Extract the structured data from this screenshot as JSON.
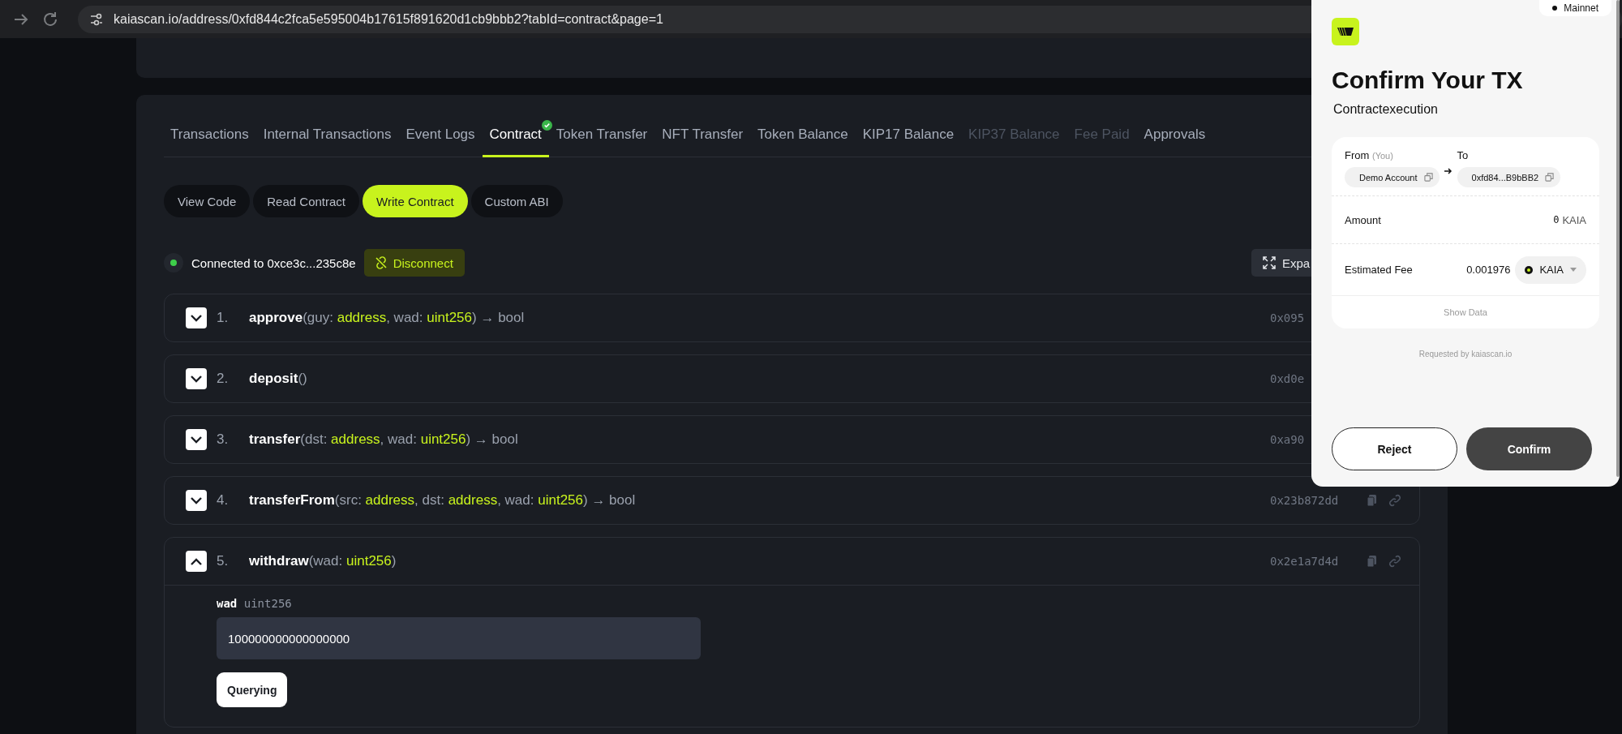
{
  "browser": {
    "url": "kaiascan.io/address/0xfd844c2fca5e595004b17615f891620d1cb9bbb2?tabId=contract&page=1"
  },
  "tabs": [
    {
      "label": "Transactions",
      "selected": false,
      "disabled": false,
      "verified": false
    },
    {
      "label": "Internal Transactions",
      "selected": false,
      "disabled": false,
      "verified": false
    },
    {
      "label": "Event Logs",
      "selected": false,
      "disabled": false,
      "verified": false
    },
    {
      "label": "Contract",
      "selected": true,
      "disabled": false,
      "verified": true
    },
    {
      "label": "Token Transfer",
      "selected": false,
      "disabled": false,
      "verified": false
    },
    {
      "label": "NFT Transfer",
      "selected": false,
      "disabled": false,
      "verified": false
    },
    {
      "label": "Token Balance",
      "selected": false,
      "disabled": false,
      "verified": false
    },
    {
      "label": "KIP17 Balance",
      "selected": false,
      "disabled": false,
      "verified": false
    },
    {
      "label": "KIP37 Balance",
      "selected": false,
      "disabled": true,
      "verified": false
    },
    {
      "label": "Fee Paid",
      "selected": false,
      "disabled": true,
      "verified": false
    },
    {
      "label": "Approvals",
      "selected": false,
      "disabled": false,
      "verified": false
    }
  ],
  "subtabs": [
    {
      "label": "View Code",
      "selected": false
    },
    {
      "label": "Read Contract",
      "selected": false
    },
    {
      "label": "Write Contract",
      "selected": true
    },
    {
      "label": "Custom ABI",
      "selected": false
    }
  ],
  "connection": {
    "connected": true,
    "text": "Connected to 0xce3c...235c8e",
    "disconnect_label": "Disconnect",
    "expand_label": "Expa"
  },
  "functions": [
    {
      "number": "1.",
      "signature": [
        {
          "kind": "name",
          "text": "approve"
        },
        {
          "kind": "plain",
          "text": "(guy: "
        },
        {
          "kind": "type",
          "text": "address"
        },
        {
          "kind": "plain",
          "text": ", wad: "
        },
        {
          "kind": "type",
          "text": "uint256"
        },
        {
          "kind": "plain",
          "text": ") → bool"
        }
      ],
      "selector": "0x095",
      "tools_shown": false,
      "expanded": false
    },
    {
      "number": "2.",
      "signature": [
        {
          "kind": "name",
          "text": "deposit"
        },
        {
          "kind": "plain",
          "text": "()"
        }
      ],
      "selector": "0xd0e",
      "tools_shown": false,
      "expanded": false
    },
    {
      "number": "3.",
      "signature": [
        {
          "kind": "name",
          "text": "transfer"
        },
        {
          "kind": "plain",
          "text": "(dst: "
        },
        {
          "kind": "type",
          "text": "address"
        },
        {
          "kind": "plain",
          "text": ", wad: "
        },
        {
          "kind": "type",
          "text": "uint256"
        },
        {
          "kind": "plain",
          "text": ") → bool"
        }
      ],
      "selector": "0xa90",
      "tools_shown": false,
      "expanded": false
    },
    {
      "number": "4.",
      "signature": [
        {
          "kind": "name",
          "text": "transferFrom"
        },
        {
          "kind": "plain",
          "text": "(src: "
        },
        {
          "kind": "type",
          "text": "address"
        },
        {
          "kind": "plain",
          "text": ", dst: "
        },
        {
          "kind": "type",
          "text": "address"
        },
        {
          "kind": "plain",
          "text": ", wad: "
        },
        {
          "kind": "type",
          "text": "uint256"
        },
        {
          "kind": "plain",
          "text": ") → bool"
        }
      ],
      "selector": "0x23b872dd",
      "tools_shown": true,
      "expanded": false
    },
    {
      "number": "5.",
      "signature": [
        {
          "kind": "name",
          "text": "withdraw"
        },
        {
          "kind": "plain",
          "text": "(wad: "
        },
        {
          "kind": "type",
          "text": "uint256"
        },
        {
          "kind": "plain",
          "text": ")"
        }
      ],
      "selector": "0x2e1a7d4d",
      "tools_shown": true,
      "expanded": true,
      "inputs": [
        {
          "name": "wad",
          "type": "uint256",
          "value": "100000000000000000"
        }
      ],
      "submit_label": "Querying"
    }
  ],
  "popup": {
    "network": "Mainnet",
    "title": "Confirm Your TX",
    "subtitle": "Contractexecution",
    "from_label": "From",
    "from_note": "(You)",
    "from_value": "Demo Account",
    "to_label": "To",
    "to_value": "0xfd84...B9bBB2",
    "amount_label": "Amount",
    "amount_value": "0",
    "amount_unit": "KAIA",
    "fee_label": "Estimated Fee",
    "fee_value": "0.001976",
    "fee_token": "KAIA",
    "show_data": "Show Data",
    "requested_by": "Requested by kaiascan.io",
    "reject_label": "Reject",
    "confirm_label": "Confirm"
  }
}
